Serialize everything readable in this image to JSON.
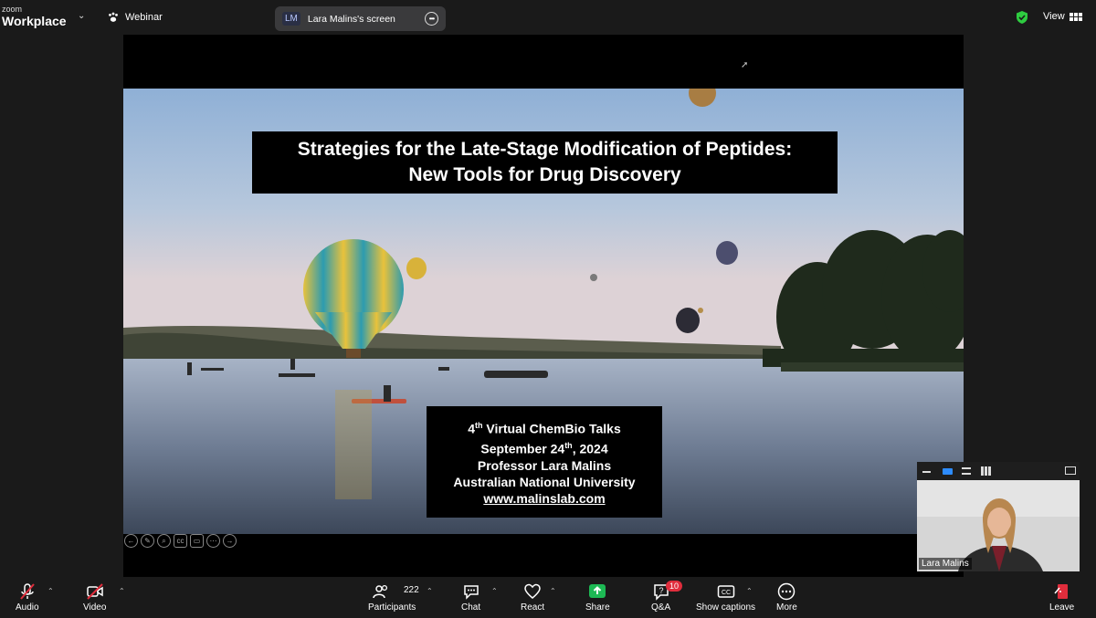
{
  "app": {
    "brand_line1": "zoom",
    "brand_line2": "Workplace",
    "mode_label": "Webinar",
    "screen_share": {
      "initials": "LM",
      "label": "Lara Malins's screen"
    },
    "view_label": "View"
  },
  "slide": {
    "title_line1": "Strategies for the Late-Stage Modification of Peptides:",
    "title_line2": "New Tools for Drug Discovery",
    "info": {
      "line1_num": "4",
      "line1_sup": "th",
      "line1_rest": " Virtual ChemBio Talks",
      "line2_pre": "September 24",
      "line2_sup": "th",
      "line2_rest": ", 2024",
      "line3": "Professor Lara Malins",
      "line4": "Australian National University",
      "url": "www.malinslab.com"
    }
  },
  "thumbnail": {
    "name": "Lara Malins"
  },
  "toolbar": {
    "audio": "Audio",
    "video": "Video",
    "participants": "Participants",
    "participants_count": "222",
    "chat": "Chat",
    "react": "React",
    "share": "Share",
    "qa": "Q&A",
    "qa_badge": "10",
    "captions": "Show captions",
    "more": "More",
    "leave": "Leave"
  },
  "colors": {
    "share_green": "#1db954",
    "leave_red": "#e02d3c",
    "shield_green": "#2ecc40",
    "muted_red": "#e02d3c"
  }
}
